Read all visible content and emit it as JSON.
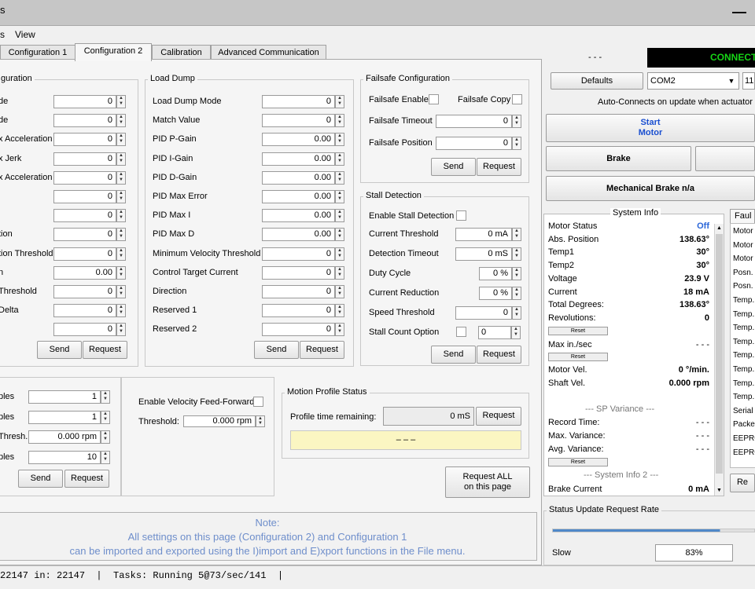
{
  "titlebar": {
    "title_fragment": "s",
    "minimize_glyph": "—"
  },
  "menu": {
    "item1": "s",
    "item2": "View"
  },
  "tabs": [
    "Configuration 1",
    "Configuration 2",
    "Calibration",
    "Advanced Communication"
  ],
  "motion_group": {
    "title": "guration",
    "rows": [
      {
        "label": "de",
        "value": "0"
      },
      {
        "label": "de",
        "value": "0"
      },
      {
        "label": "x Acceleration",
        "value": "0"
      },
      {
        "label": "x Jerk",
        "value": "0"
      },
      {
        "label": "x Acceleration",
        "value": "0"
      },
      {
        "label": "",
        "value": "0"
      },
      {
        "label": "",
        "value": "0"
      },
      {
        "label": "tion",
        "value": "0"
      },
      {
        "label": "tion Threshold",
        "value": "0"
      },
      {
        "label": "n",
        "value": "0.00"
      },
      {
        "label": " Threshold",
        "value": "0"
      },
      {
        "label": "Delta",
        "value": "0"
      },
      {
        "label": "",
        "value": "0"
      }
    ],
    "send": "Send",
    "request": "Request"
  },
  "load_dump": {
    "title": "Load Dump",
    "rows": [
      {
        "label": "Load Dump Mode",
        "value": "0"
      },
      {
        "label": "Match Value",
        "value": "0"
      },
      {
        "label": "PID  P-Gain",
        "value": "0.00"
      },
      {
        "label": "PID  I-Gain",
        "value": "0.00"
      },
      {
        "label": "PID  D-Gain",
        "value": "0.00"
      },
      {
        "label": "PID Max Error",
        "value": "0.00"
      },
      {
        "label": "PID Max I",
        "value": "0.00"
      },
      {
        "label": "PID Max D",
        "value": "0.00"
      },
      {
        "label": "Minimum Velocity Threshold",
        "value": "0"
      },
      {
        "label": "Control Target Current",
        "value": "0"
      },
      {
        "label": "Direction",
        "value": "0"
      },
      {
        "label": "Reserved 1",
        "value": "0"
      },
      {
        "label": "Reserved 2",
        "value": "0"
      }
    ],
    "send": "Send",
    "request": "Request"
  },
  "failsafe": {
    "title": "Failsafe Configuration",
    "enable_label": "Failsafe Enable",
    "copy_label": "Failsafe Copy",
    "timeout_label": "Failsafe Timeout",
    "timeout_value": "0",
    "position_label": "Failsafe Position",
    "position_value": "0",
    "send": "Send",
    "request": "Request"
  },
  "stall": {
    "title": "Stall Detection",
    "enable_label": "Enable Stall Detection",
    "rows": [
      {
        "label": "Current Threshold",
        "value": "0 mA"
      },
      {
        "label": "Detection Timeout",
        "value": "0 mS"
      },
      {
        "label": "Duty Cycle",
        "value": "0 %"
      },
      {
        "label": "Current Reduction",
        "value": "0 %"
      },
      {
        "label": "Speed Threshold",
        "value": "0"
      }
    ],
    "count_label": "Stall Count Option",
    "count_value": "0",
    "send": "Send",
    "request": "Request"
  },
  "samples_group": {
    "rows": [
      {
        "label": "ples",
        "value": "1"
      },
      {
        "label": "ples",
        "value": "1"
      },
      {
        "label": "Thresh.",
        "value": "0.000 rpm"
      },
      {
        "label": "ples",
        "value": "10"
      }
    ],
    "send": "Send",
    "request": "Request"
  },
  "velocity": {
    "ff_label": "Enable Velocity Feed-Forward",
    "threshold_label": "Threshold:",
    "threshold_value": "0.000 rpm"
  },
  "motion_profile": {
    "title": "Motion Profile Status",
    "remaining_label": "Profile time remaining:",
    "remaining_value": "0 mS",
    "request": "Request",
    "status_text": "– – –"
  },
  "request_all": {
    "line1": "Request ALL",
    "line2": "on this page"
  },
  "note": {
    "title": "Note:",
    "line1": "All settings on this page (Configuration 2) and Configuration 1",
    "line2": "can be imported and exported using the I)import and E)xport functions in the File menu."
  },
  "status_bar": {
    "text": "22147 in: 22147  |  Tasks: Running 5@73/sec/141  |"
  },
  "connection": {
    "dashes": "- - -",
    "banner": "CONNECT",
    "defaults": "Defaults",
    "port": "COM2",
    "baud": "11",
    "autoconnect": "Auto-Connects on update when actuator is"
  },
  "controls": {
    "start_line1": "Start",
    "start_line2": "Motor",
    "brake": "Brake",
    "mech_brake": "Mechanical Brake n/a"
  },
  "system_info": {
    "title": "System Info",
    "rows": [
      {
        "label": "Motor Status",
        "value": "Off"
      },
      {
        "label": "Abs. Position",
        "value": "138.63°"
      },
      {
        "label": "Temp1",
        "value": "30°"
      },
      {
        "label": "Temp2",
        "value": "30°"
      },
      {
        "label": "Voltage",
        "value": "23.9 V"
      },
      {
        "label": "Current",
        "value": "18 mA"
      },
      {
        "label": "Total Degrees:",
        "value": "138.63°"
      },
      {
        "label": "Revolutions:",
        "value": "0"
      }
    ],
    "reset": "Reset",
    "max_label": "Max in./sec",
    "max_value": "- - -",
    "motor_vel_label": "Motor Vel.",
    "motor_vel_value": "0 °/min.",
    "shaft_vel_label": "Shaft Vel.",
    "shaft_vel_value": "0.000 rpm",
    "sp_title": "--- SP Variance ---",
    "record_label": "Record Time:",
    "record_value": "- - -",
    "maxvar_label": "Max. Variance:",
    "maxvar_value": "- - -",
    "avgvar_label": "Avg. Variance:",
    "avgvar_value": "- - -",
    "sys2_title": "--- System Info 2 ---",
    "brake_label": "Brake Current",
    "brake_value": "0 mA"
  },
  "faults": {
    "title": "Faul",
    "items": [
      "Motor",
      "Motor",
      "Motor",
      "Posn.",
      "Posn.",
      "Temp.",
      "Temp.",
      "Temp.",
      "Temp.",
      "Temp.",
      "Temp.",
      "Temp.",
      "Temp.",
      "Serial",
      "Packe",
      "EEPRO",
      "EEPRO"
    ],
    "reset": "Re"
  },
  "update_rate": {
    "title": "Status Update Request Rate",
    "slow": "Slow",
    "value": "83%",
    "level": 0.83
  },
  "colors": {
    "motor_off": "#2a66d8",
    "start_text": "#1a4fd0",
    "connected_green": "#16d416",
    "note_text": "#6e8ecb"
  }
}
